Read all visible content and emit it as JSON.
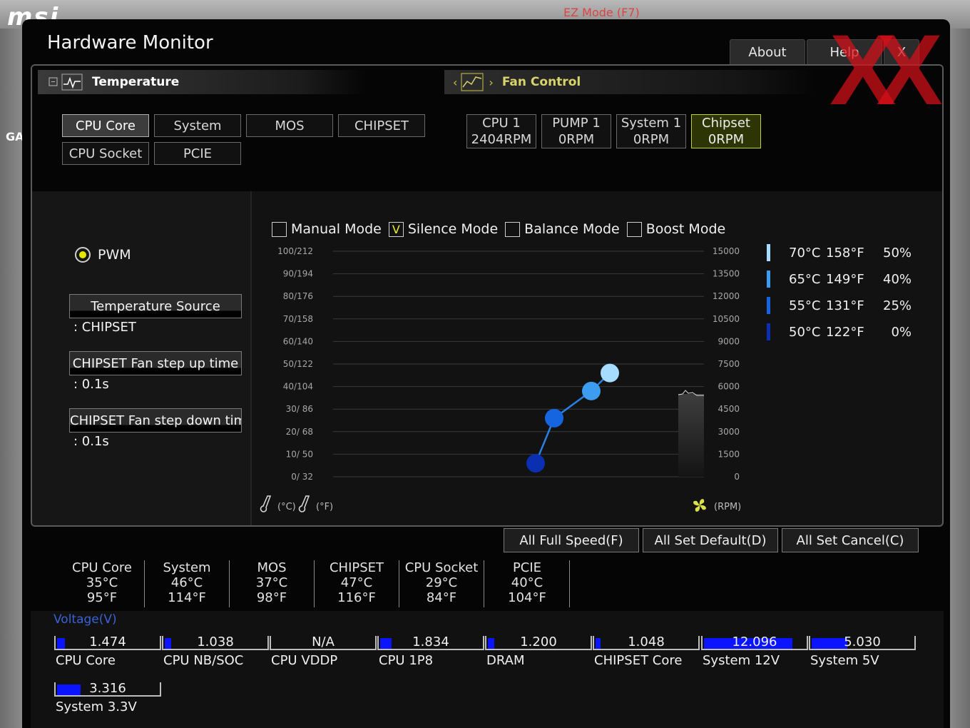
{
  "background": {
    "logo_text": "msi",
    "ez_mode": "EZ Mode (F7)",
    "side_label": "GA"
  },
  "window": {
    "title": "Hardware Monitor"
  },
  "top_buttons": {
    "about": "About",
    "help": "Help",
    "close": "X"
  },
  "tabs": {
    "temperature": "Temperature",
    "fan_control": "Fan Control"
  },
  "sensors": [
    {
      "label": "CPU Core",
      "selected": true
    },
    {
      "label": "System",
      "selected": false
    },
    {
      "label": "MOS",
      "selected": false
    },
    {
      "label": "CHIPSET",
      "selected": false
    },
    {
      "label": "CPU Socket",
      "selected": false
    },
    {
      "label": "PCIE",
      "selected": false
    }
  ],
  "fans": [
    {
      "name": "CPU 1",
      "rpm": "2404RPM",
      "selected": false
    },
    {
      "name": "PUMP 1",
      "rpm": "0RPM",
      "selected": false
    },
    {
      "name": "System 1",
      "rpm": "0RPM",
      "selected": false
    },
    {
      "name": "Chipset",
      "rpm": "0RPM",
      "selected": true
    }
  ],
  "left_panel": {
    "pwm_label": "PWM",
    "temp_source_label": "Temperature Source",
    "temp_source_value": ": CHIPSET",
    "step_up_label": "CHIPSET Fan step up time",
    "step_up_value": ": 0.1s",
    "step_down_label": "CHIPSET Fan step down tim",
    "step_down_value": ": 0.1s"
  },
  "modes": [
    {
      "label": "Manual Mode",
      "checked": false
    },
    {
      "label": "Silence Mode",
      "checked": true
    },
    {
      "label": "Balance Mode",
      "checked": false
    },
    {
      "label": "Boost Mode",
      "checked": false
    }
  ],
  "check_mark": "V",
  "chart_data": {
    "type": "line",
    "y_left_ticks": [
      "100/212",
      "90/194",
      "80/176",
      "70/158",
      "60/140",
      "50/122",
      "40/104",
      "30/ 86",
      "20/ 68",
      "10/ 50",
      "0/ 32"
    ],
    "y_right_ticks": [
      "15000",
      "13500",
      "12000",
      "10500",
      "9000",
      "7500",
      "6000",
      "4500",
      "3000",
      "1500",
      "0"
    ],
    "ylim": [
      0,
      100
    ],
    "x_unit_c": "(°C)",
    "x_unit_f": "(°F)",
    "rpm_unit": "(RPM)",
    "series": [
      {
        "points": [
          {
            "temp_c": 50,
            "fan_pct": 0,
            "color": "#0a2fb0"
          },
          {
            "temp_c": 55,
            "fan_pct": 25,
            "color": "#1565e0"
          },
          {
            "temp_c": 65,
            "fan_pct": 40,
            "color": "#3c9cf0"
          },
          {
            "temp_c": 70,
            "fan_pct": 50,
            "color": "#a6dcff"
          }
        ]
      }
    ]
  },
  "legend": [
    {
      "c": "70°C",
      "f": "158°F",
      "pct": "50%",
      "color": "#a6dcff"
    },
    {
      "c": "65°C",
      "f": "149°F",
      "pct": "40%",
      "color": "#3c9cf0"
    },
    {
      "c": "55°C",
      "f": "131°F",
      "pct": "25%",
      "color": "#1565e0"
    },
    {
      "c": "50°C",
      "f": "122°F",
      "pct": "0%",
      "color": "#0a2fb0"
    }
  ],
  "actions": {
    "full_speed": "All Full Speed(F)",
    "set_default": "All Set Default(D)",
    "set_cancel": "All Set Cancel(C)"
  },
  "temperatures": [
    {
      "name": "CPU Core",
      "c": "35°C",
      "f": "95°F"
    },
    {
      "name": "System",
      "c": "46°C",
      "f": "114°F"
    },
    {
      "name": "MOS",
      "c": "37°C",
      "f": "98°F"
    },
    {
      "name": "CHIPSET",
      "c": "47°C",
      "f": "116°F"
    },
    {
      "name": "CPU Socket",
      "c": "29°C",
      "f": "84°F"
    },
    {
      "name": "PCIE",
      "c": "40°C",
      "f": "104°F"
    }
  ],
  "voltage_title": "Voltage(V)",
  "voltages": [
    {
      "name": "CPU Core",
      "value": "1.474",
      "fill": 0.08
    },
    {
      "name": "CPU NB/SOC",
      "value": "1.038",
      "fill": 0.06
    },
    {
      "name": "CPU VDDP",
      "value": "N/A",
      "fill": 0
    },
    {
      "name": "CPU 1P8",
      "value": "1.834",
      "fill": 0.11
    },
    {
      "name": "DRAM",
      "value": "1.200",
      "fill": 0.06
    },
    {
      "name": "CHIPSET Core",
      "value": "1.048",
      "fill": 0.05
    },
    {
      "name": "System 12V",
      "value": "12.096",
      "fill": 0.87
    },
    {
      "name": "System 5V",
      "value": "5.030",
      "fill": 0.35
    },
    {
      "name": "System 3.3V",
      "value": "3.316",
      "fill": 0.23
    }
  ]
}
